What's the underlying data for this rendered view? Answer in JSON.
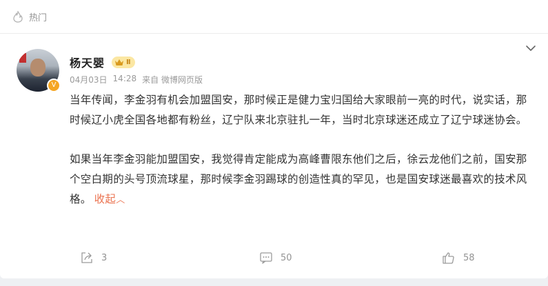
{
  "header": {
    "hot_label": "热门",
    "hot_icon": "fire-icon"
  },
  "post": {
    "author": {
      "name": "杨天婴",
      "level": "Ⅱ",
      "verified_badge": "V"
    },
    "meta": {
      "date": "04月03日",
      "time": "14:28",
      "source": "来自 微博网页版"
    },
    "paragraphs": [
      "当年传闻，李金羽有机会加盟国安，那时候正是健力宝归国给大家眼前一亮的时代，说实话，那时候辽小虎全国各地都有粉丝，辽宁队来北京驻扎一年，当时北京球迷还成立了辽宁球迷协会。",
      "如果当年李金羽能加盟国安，我觉得肯定能成为高峰曹限东他们之后，徐云龙他们之前，国安那个空白期的头号顶流球星，那时候李金羽踢球的创造性真的罕见，也是国安球迷最喜欢的技术风格。"
    ],
    "collapse_label": "收起",
    "collapse_caret": "︿"
  },
  "actions": {
    "repost_count": "3",
    "comment_count": "50",
    "like_count": "58"
  },
  "colors": {
    "accent": "#eb7350",
    "meta_gray": "#9a9a9a",
    "badge_gold": "#f5a623"
  }
}
